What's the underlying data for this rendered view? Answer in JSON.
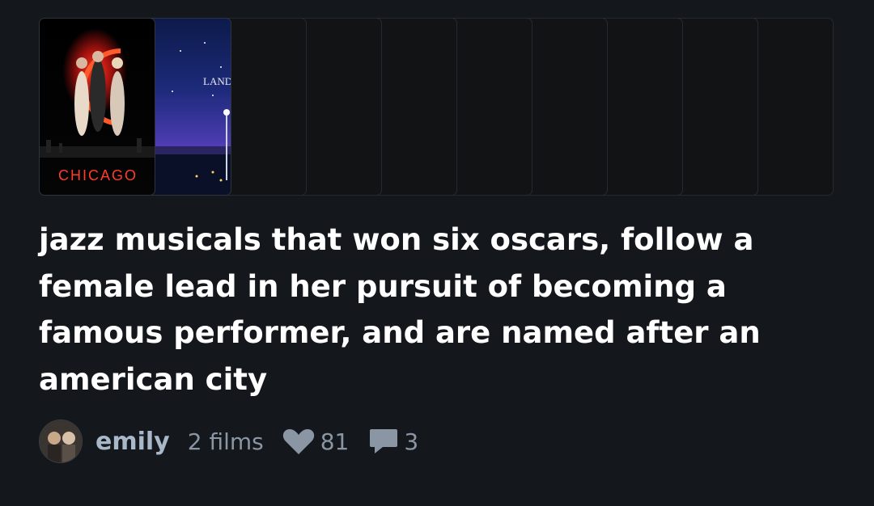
{
  "list": {
    "posters": [
      {
        "title": "CHICAGO"
      },
      {
        "title": "LA LA LAND",
        "visible_text": "LAND"
      }
    ],
    "title": "jazz musicals that won six oscars, follow a female lead in her pursuit of becoming a famous performer, and are named after an american city",
    "author": {
      "name": "emily"
    },
    "film_count": "2 films",
    "likes": "81",
    "comments": "3"
  },
  "colors": {
    "background": "#14181c",
    "title": "#ffffff",
    "username": "#a9b8c8",
    "meta": "#8a96a4"
  },
  "icons": [
    "heart-icon",
    "comment-icon"
  ]
}
